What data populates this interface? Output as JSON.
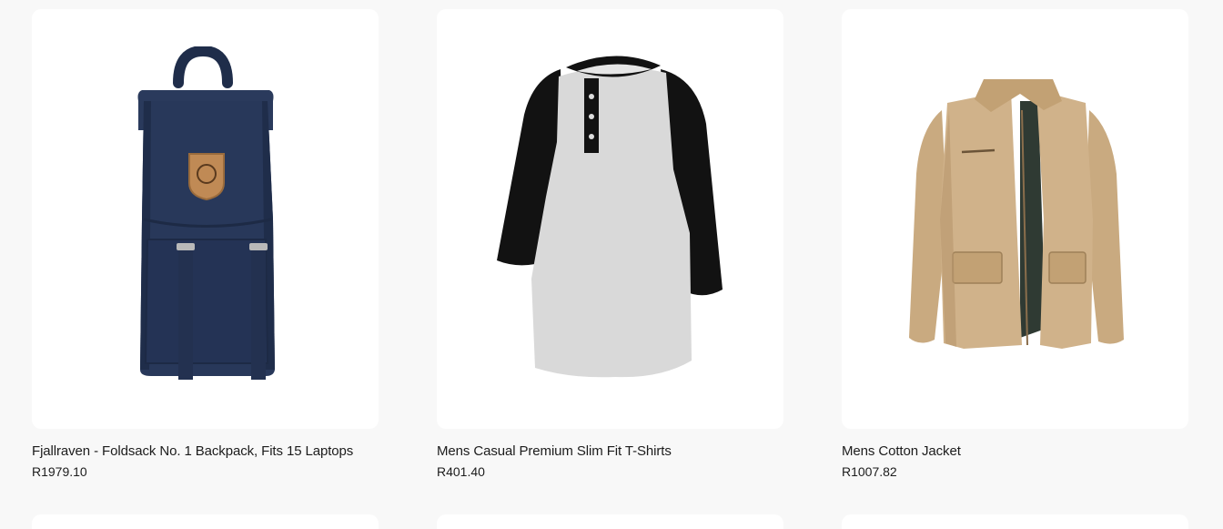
{
  "products": [
    {
      "title": "Fjallraven - Foldsack No. 1 Backpack, Fits 15 Laptops",
      "price": "R1979.10",
      "image_icon": "backpack-icon",
      "colors": {
        "main": "#28385a",
        "dark": "#1d2a45",
        "patch": "#c08a55"
      }
    },
    {
      "title": "Mens Casual Premium Slim Fit T-Shirts",
      "price": "R401.40",
      "image_icon": "tshirt-icon",
      "colors": {
        "body": "#d9d9d9",
        "sleeve": "#121212"
      }
    },
    {
      "title": "Mens Cotton Jacket",
      "price": "R1007.82",
      "image_icon": "jacket-icon",
      "colors": {
        "main": "#d0b28a",
        "shade": "#b7966c",
        "lining": "#2f3a33"
      }
    }
  ],
  "page": {
    "background": "#f8f8f8",
    "card_background": "#ffffff"
  }
}
